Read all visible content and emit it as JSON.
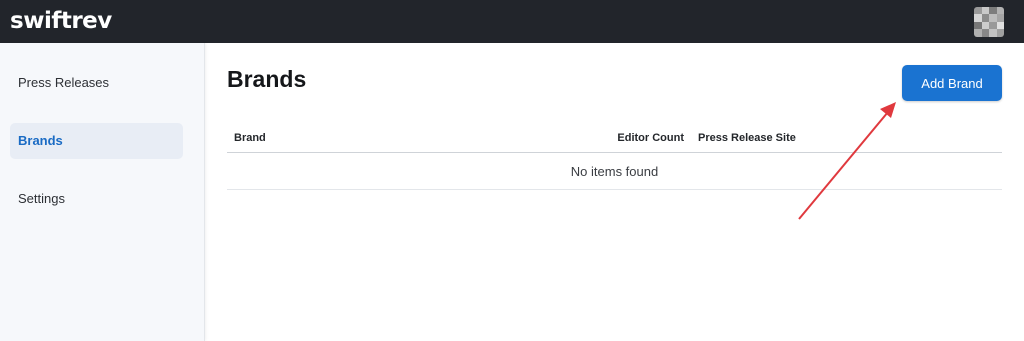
{
  "app": {
    "logo_text": "swiftrev"
  },
  "header": {
    "avatar_colors": [
      "#9a9a9a",
      "#c9c9c9",
      "#7d7d7d",
      "#b3b3b3",
      "#d6d6d6",
      "#8c8c8c",
      "#bdbdbd",
      "#a5a5a5",
      "#777777",
      "#cccccc",
      "#999999",
      "#e0e0e0",
      "#b0b0b0",
      "#888888",
      "#c2c2c2",
      "#a0a0a0"
    ]
  },
  "sidebar": {
    "items": [
      {
        "label": "Press Releases",
        "active": false
      },
      {
        "label": "Brands",
        "active": true
      },
      {
        "label": "Settings",
        "active": false
      }
    ]
  },
  "main": {
    "title": "Brands",
    "add_button_label": "Add Brand",
    "table": {
      "columns": [
        "Brand",
        "Editor Count",
        "Press Release Site"
      ],
      "empty_message": "No items found"
    }
  },
  "colors": {
    "topbar": "#22252b",
    "accent": "#1a73d1",
    "active_nav_text": "#1a6bc4",
    "annotation_arrow": "#e0393e"
  }
}
